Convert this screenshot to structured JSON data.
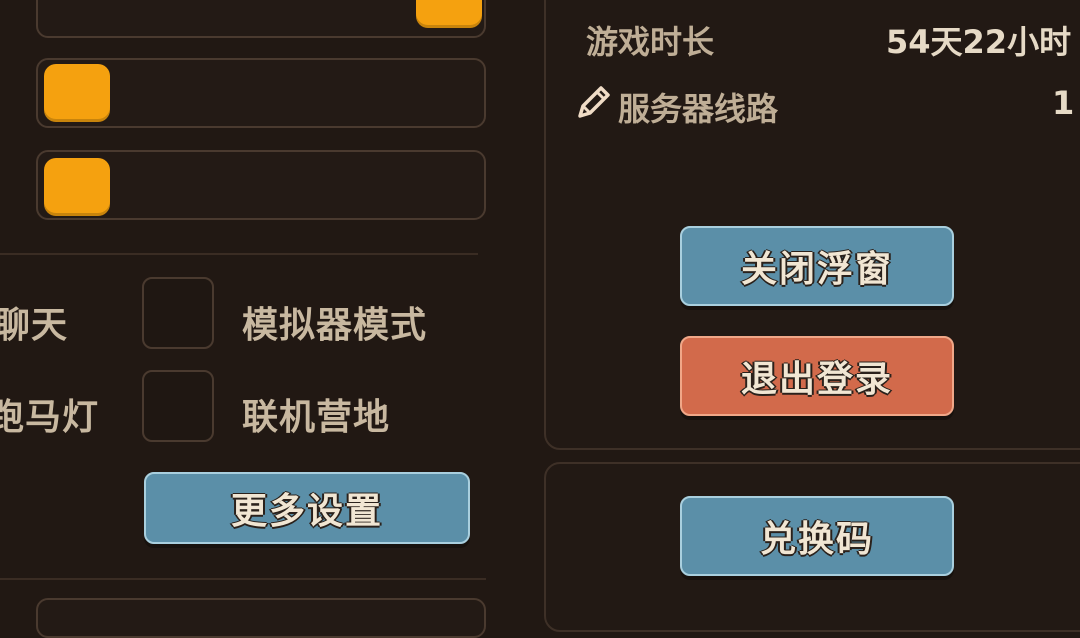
{
  "settings": {
    "sliders": [
      {
        "name": "slider-1",
        "value_fraction": 1.0
      },
      {
        "name": "slider-2",
        "value_fraction": 0.0
      },
      {
        "name": "slider-3",
        "value_fraction": 0.0
      }
    ],
    "toggles": [
      {
        "label": "聊天",
        "checked": false
      },
      {
        "label": "模拟器模式",
        "checked": false
      },
      {
        "label": "跑马灯",
        "checked": false
      },
      {
        "label": "联机营地",
        "checked": false
      }
    ],
    "more_settings_label": "更多设置"
  },
  "account": {
    "play_time_label": "游戏时长",
    "play_time_value": "54天22小时",
    "server_line_label": "服务器线路",
    "server_line_value": "1",
    "close_float_label": "关闭浮窗",
    "logout_label": "退出登录"
  },
  "redeem": {
    "redeem_label": "兑换码"
  },
  "colors": {
    "background": "#211813",
    "knob": "#f5a10f",
    "button_blue": "#5b8fa8",
    "button_red": "#d26a4b"
  }
}
